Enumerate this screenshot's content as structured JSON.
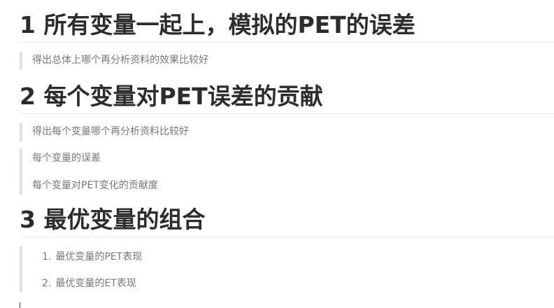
{
  "sections": [
    {
      "heading": "1 所有变量一起上，模拟的PET的误差",
      "quote_lines": [
        "得出总体上哪个再分析资料的效果比较好"
      ]
    },
    {
      "heading": "2 每个变量对PET误差的贡献",
      "quote_lines": [
        "得出每个变量哪个再分析资料比较好"
      ],
      "quote2_lines": [
        "每个变量的误差",
        "每个变量对PET变化的贡献度"
      ]
    },
    {
      "heading": "3 最优变量的组合",
      "list_items": [
        {
          "num": "1.",
          "text": "最优变量的PET表现"
        },
        {
          "num": "2.",
          "text": "最优变量的ET表现"
        }
      ]
    }
  ]
}
